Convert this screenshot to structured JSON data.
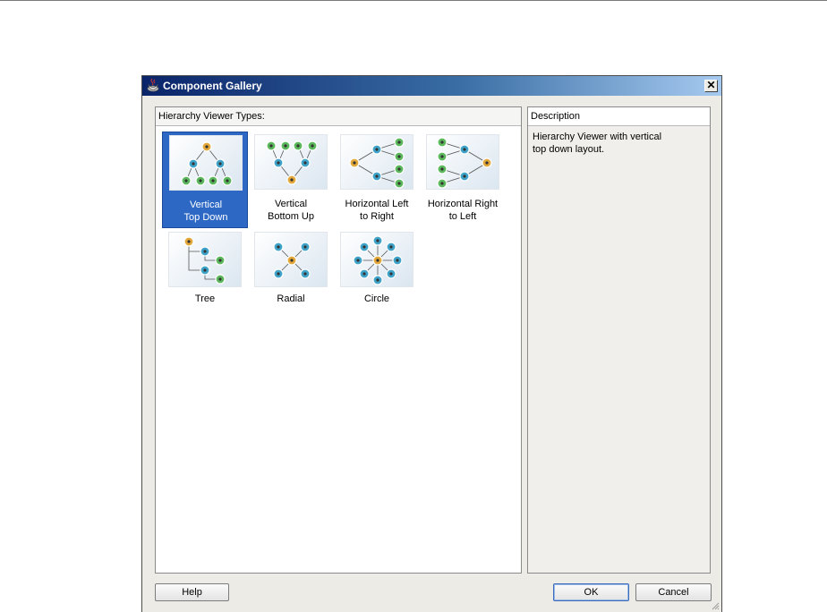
{
  "dialog": {
    "title": "Component Gallery",
    "close_label": "✕",
    "types_header": "Hierarchy Viewer Types:",
    "description_header": "Description",
    "description_lines": [
      "Hierarchy Viewer with vertical",
      "top down layout."
    ],
    "tiles": [
      {
        "line1": "Vertical",
        "line2": "Top Down",
        "icon": "vertical-top-down-icon",
        "selected": true
      },
      {
        "line1": "Vertical",
        "line2": "Bottom Up",
        "icon": "vertical-bottom-up-icon",
        "selected": false
      },
      {
        "line1": "Horizontal Left",
        "line2": "to Right",
        "icon": "horizontal-left-to-right-icon",
        "selected": false
      },
      {
        "line1": "Horizontal Right",
        "line2": "to Left",
        "icon": "horizontal-right-to-left-icon",
        "selected": false
      },
      {
        "line1": "Tree",
        "line2": "",
        "icon": "tree-icon",
        "selected": false
      },
      {
        "line1": "Radial",
        "line2": "",
        "icon": "radial-icon",
        "selected": false
      },
      {
        "line1": "Circle",
        "line2": "",
        "icon": "circle-icon",
        "selected": false
      }
    ],
    "buttons": {
      "help": "Help",
      "ok": "OK",
      "cancel": "Cancel"
    }
  },
  "colors": {
    "root_node": "#e3a83a",
    "mid_node": "#3fa3c9",
    "leaf_node": "#5cb85c",
    "selection": "#2d68c5",
    "titlebar": "#0a246a"
  }
}
